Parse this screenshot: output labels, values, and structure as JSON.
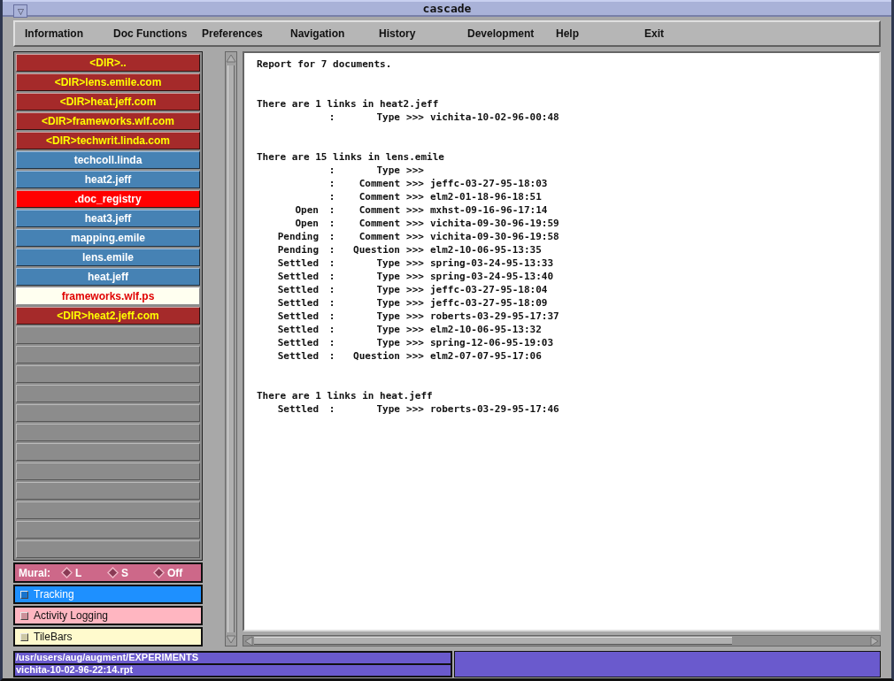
{
  "window": {
    "title": "cascade",
    "menu_glyph": "▽"
  },
  "menu": [
    "Information",
    "Doc Functions",
    "Preferences",
    "Navigation",
    "History",
    "Development",
    "Help",
    "Exit"
  ],
  "files": [
    {
      "label": "<DIR>..",
      "kind": "dir"
    },
    {
      "label": "<DIR>lens.emile.com",
      "kind": "dir"
    },
    {
      "label": "<DIR>heat.jeff.com",
      "kind": "dir"
    },
    {
      "label": "<DIR>frameworks.wlf.com",
      "kind": "dir"
    },
    {
      "label": "<DIR>techwrit.linda.com",
      "kind": "dir"
    },
    {
      "label": "techcoll.linda",
      "kind": "doc"
    },
    {
      "label": "heat2.jeff",
      "kind": "doc"
    },
    {
      "label": ".doc_registry",
      "kind": "registry"
    },
    {
      "label": "heat3.jeff",
      "kind": "doc"
    },
    {
      "label": "mapping.emile",
      "kind": "doc"
    },
    {
      "label": "lens.emile",
      "kind": "doc"
    },
    {
      "label": "heat.jeff",
      "kind": "doc"
    },
    {
      "label": "frameworks.wlf.ps",
      "kind": "ps"
    },
    {
      "label": "<DIR>heat2.jeff.com",
      "kind": "dir"
    }
  ],
  "mural": {
    "label": "Mural:",
    "options": [
      {
        "label": "L",
        "selected": false
      },
      {
        "label": "S",
        "selected": false
      },
      {
        "label": "Off",
        "selected": false
      }
    ]
  },
  "toggles": [
    {
      "label": "Tracking",
      "checked": false,
      "color": "#1e90ff"
    },
    {
      "label": "Activity Logging",
      "checked": false,
      "color": "#ffb6c1"
    },
    {
      "label": "TileBars",
      "checked": false,
      "color": "#fffacd"
    }
  ],
  "report": {
    "heading": "Report for 7 documents.",
    "sections": [
      {
        "title": "There are 1 links in heat2.jeff",
        "links": [
          {
            "colon": ":",
            "kind": "Type",
            "arrow": ">>>",
            "target": "vichita-10-02-96-00:48"
          }
        ]
      },
      {
        "title": "There are 15 links in lens.emile",
        "links": [
          {
            "colon": ":",
            "kind": "Type",
            "arrow": ">>>"
          },
          {
            "colon": ":",
            "kind": "Comment",
            "arrow": ">>>",
            "target": "jeffc-03-27-95-18:03"
          },
          {
            "colon": ":",
            "kind": "Comment",
            "arrow": ">>>",
            "target": "elm2-01-18-96-18:51"
          },
          {
            "status": "Open",
            "colon": ":",
            "kind": "Comment",
            "arrow": ">>>",
            "target": "mxhst-09-16-96-17:14"
          },
          {
            "status": "Open",
            "colon": ":",
            "kind": "Comment",
            "arrow": ">>>",
            "target": "vichita-09-30-96-19:59"
          },
          {
            "status": "Pending",
            "colon": ":",
            "kind": "Comment",
            "arrow": ">>>",
            "target": "vichita-09-30-96-19:58"
          },
          {
            "status": "Pending",
            "colon": ":",
            "kind": "Question",
            "arrow": ">>>",
            "target": "elm2-10-06-95-13:35"
          },
          {
            "status": "Settled",
            "colon": ":",
            "kind": "Type",
            "arrow": ">>>",
            "target": "spring-03-24-95-13:33"
          },
          {
            "status": "Settled",
            "colon": ":",
            "kind": "Type",
            "arrow": ">>>",
            "target": "spring-03-24-95-13:40"
          },
          {
            "status": "Settled",
            "colon": ":",
            "kind": "Type",
            "arrow": ">>>",
            "target": "jeffc-03-27-95-18:04"
          },
          {
            "status": "Settled",
            "colon": ":",
            "kind": "Type",
            "arrow": ">>>",
            "target": "jeffc-03-27-95-18:09"
          },
          {
            "status": "Settled",
            "colon": ":",
            "kind": "Type",
            "arrow": ">>>",
            "target": "roberts-03-29-95-17:37"
          },
          {
            "status": "Settled",
            "colon": ":",
            "kind": "Type",
            "arrow": ">>>",
            "target": "elm2-10-06-95-13:32"
          },
          {
            "status": "Settled",
            "colon": ":",
            "kind": "Type",
            "arrow": ">>>",
            "target": "spring-12-06-95-19:03"
          },
          {
            "status": "Settled",
            "colon": ":",
            "kind": "Question",
            "arrow": ">>>",
            "target": "elm2-07-07-95-17:06"
          }
        ]
      },
      {
        "title": "There are 1 links in heat.jeff",
        "links": [
          {
            "status": "Settled",
            "colon": ":",
            "kind": "Type",
            "arrow": ">>>",
            "target": "roberts-03-29-95-17:46"
          }
        ]
      }
    ]
  },
  "status_bar": {
    "path": "/usr/users/aug/augment/EXPERIMENTS",
    "file": "vichita-10-02-96-22:14.rpt"
  }
}
